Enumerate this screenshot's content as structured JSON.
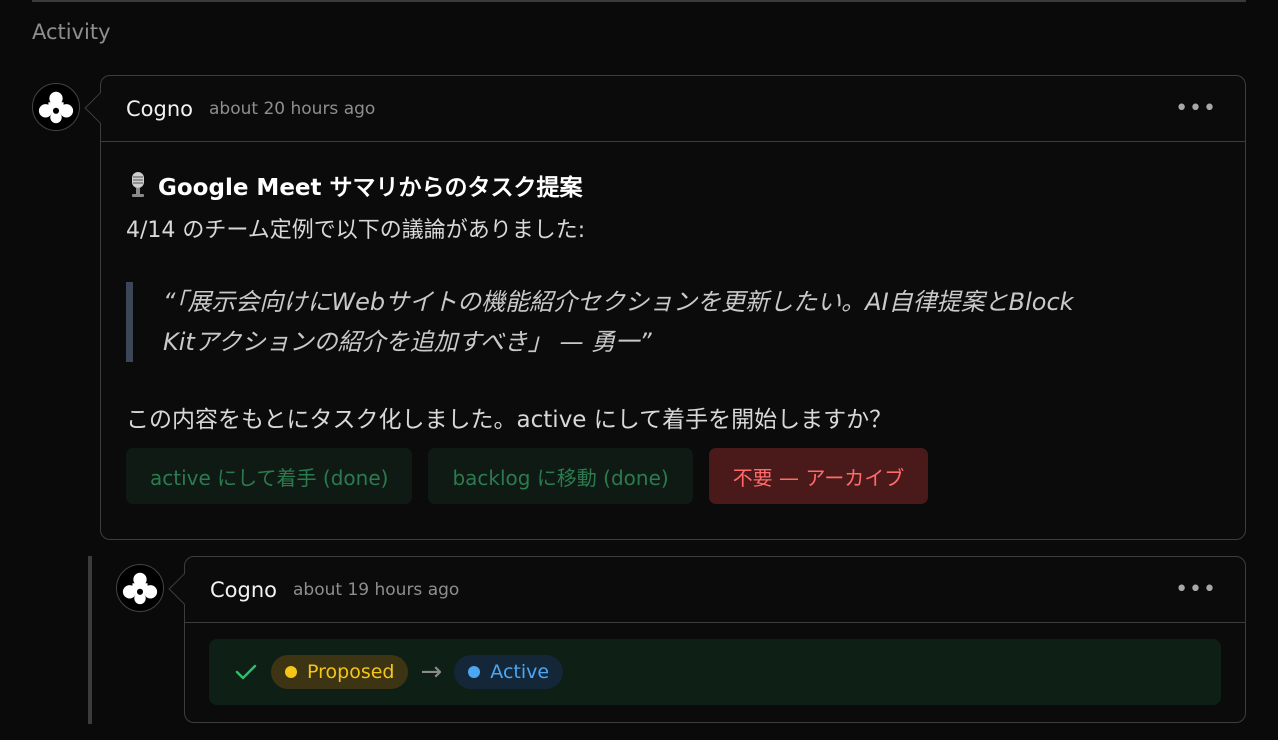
{
  "section": {
    "title": "Activity"
  },
  "comments": [
    {
      "author": "Cogno",
      "time": "about 20 hours ago",
      "more_icon": "•••",
      "heading": "Google Meet サマリからのタスク提案",
      "lead": "4/14 のチーム定例で以下の議論がありました:",
      "quote_line1": "“「展示会向けにWebサイトの機能紹介セクションを更新したい。AI自律提案とBlock",
      "quote_line2": "Kitアクションの紹介を追加すべき」 — 勇一”",
      "ask": "この内容をもとにタスク化しました。active にして着手を開始しますか？",
      "actions": [
        {
          "label": "active にして着手 (done)",
          "kind": "done"
        },
        {
          "label": "backlog に移動 (done)",
          "kind": "done"
        },
        {
          "label": "不要 — アーカイブ",
          "kind": "danger"
        }
      ]
    },
    {
      "author": "Cogno",
      "time": "about 19 hours ago",
      "more_icon": "•••",
      "status_from": "Proposed",
      "arrow": "→",
      "status_to": "Active"
    }
  ],
  "colors": {
    "accent_done": "#2b7b4e",
    "danger": "#ff6b6b",
    "proposed": "#f5c518",
    "active": "#4da6f2"
  }
}
